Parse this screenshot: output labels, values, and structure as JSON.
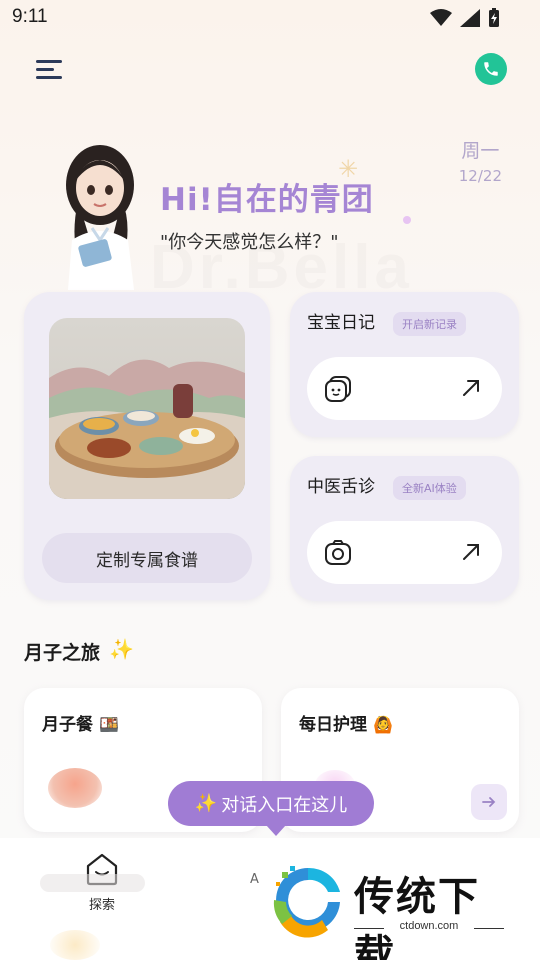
{
  "status_bar": {
    "time": "9:11"
  },
  "header": {
    "menu_icon": "menu-icon",
    "phone_icon": "phone-icon",
    "date_day": "周一",
    "date_num": "12/22"
  },
  "hero": {
    "greeting": "Hi!自在的青团",
    "sub_greeting": "\"你今天感觉怎么样？\"",
    "background_text": "Dr.Bella"
  },
  "recipe_card": {
    "button_label": "定制专属食谱"
  },
  "diary_card": {
    "title": "宝宝日记",
    "badge": "开启新记录"
  },
  "tongue_card": {
    "title": "中医舌诊",
    "badge": "全新AI体验"
  },
  "journey": {
    "title": "月子之旅",
    "cards": [
      {
        "title": "月子餐",
        "emoji": "🍱"
      },
      {
        "title": "每日护理",
        "emoji": "🙆"
      }
    ]
  },
  "chat_entry": {
    "label": "对话入口在这儿"
  },
  "tabbar": {
    "explore_label": "探索",
    "ai_label_partial": "A"
  },
  "watermark": {
    "brand": "传统下载",
    "url": "ctdown.com"
  },
  "colors": {
    "accent_purple": "#a07cd4",
    "greeting_purple": "#a585d4",
    "phone_green": "#22c497",
    "card_bg": "#efecf5"
  }
}
